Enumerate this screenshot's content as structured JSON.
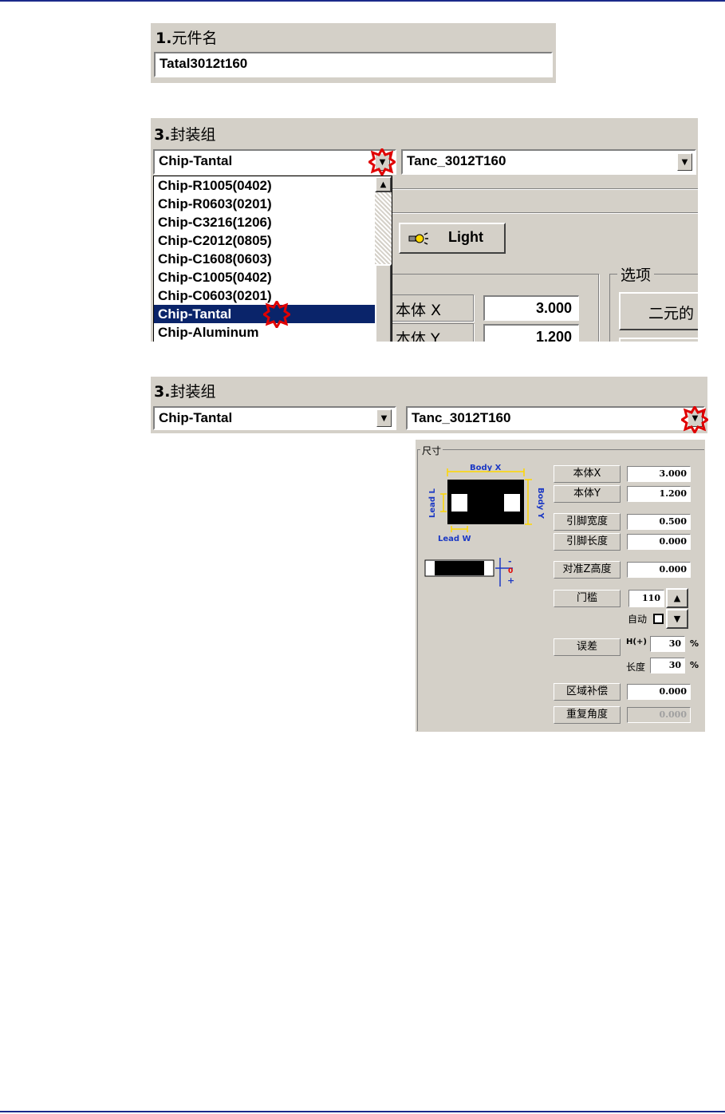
{
  "section1": {
    "label_num": "1.",
    "label": "元件名",
    "value": "Tatal3012t160"
  },
  "section3a": {
    "label_num": "3.",
    "label": "封装组",
    "group_value": "Chip-Tantal",
    "package_value": "Tanc_3012T160",
    "list_items": [
      "Chip-R1005(0402)",
      "Chip-R0603(0201)",
      "Chip-C3216(1206)",
      "Chip-C2012(0805)",
      "Chip-C1608(0603)",
      "Chip-C1005(0402)",
      "Chip-C0603(0201)",
      "Chip-Tantal",
      "Chip-Aluminum"
    ],
    "selected_index": 7,
    "light_button": "Light",
    "options_label": "选项",
    "options_button": "二元的",
    "body_x_label": "本体 X",
    "body_x_value": "3.000",
    "body_y_label": "本体 Y",
    "body_y_value": "1.200"
  },
  "section3b": {
    "label_num": "3.",
    "label": "封装组",
    "group_value": "Chip-Tantal",
    "package_value": "Tanc_3012T160"
  },
  "dimensions": {
    "title": "尺寸",
    "diagram": {
      "body_x": "Body X",
      "body_y": "Body Y",
      "lead_l": "Lead L",
      "lead_w": "Lead W",
      "minus": "-",
      "zero": "0",
      "plus": "+"
    },
    "rows": {
      "body_x": {
        "label": "本体X",
        "value": "3.000"
      },
      "body_y": {
        "label": "本体Y",
        "value": "1.200"
      },
      "lead_width": {
        "label": "引脚宽度",
        "value": "0.500"
      },
      "lead_length": {
        "label": "引脚长度",
        "value": "0.000"
      },
      "align_z": {
        "label": "对准Z高度",
        "value": "0.000"
      },
      "threshold": {
        "label": "门槛",
        "value": "110"
      },
      "auto": {
        "label": "自动"
      },
      "tolerance": {
        "label": "误差",
        "h_label": "H(+)",
        "h_value": "30",
        "l_label": "长度",
        "l_value": "30",
        "unit": "%"
      },
      "area_comp": {
        "label": "区域补偿",
        "value": "0.000"
      },
      "repeat_angle": {
        "label": "重复角度",
        "value": "0.000"
      }
    }
  },
  "colors": {
    "panel": "#d4d0c8",
    "selection": "#0a246a",
    "marker": "#e00000",
    "rule": "#1a2a8a",
    "diagram_yellow": "#ffd700",
    "diagram_blue": "#1c39c4"
  }
}
